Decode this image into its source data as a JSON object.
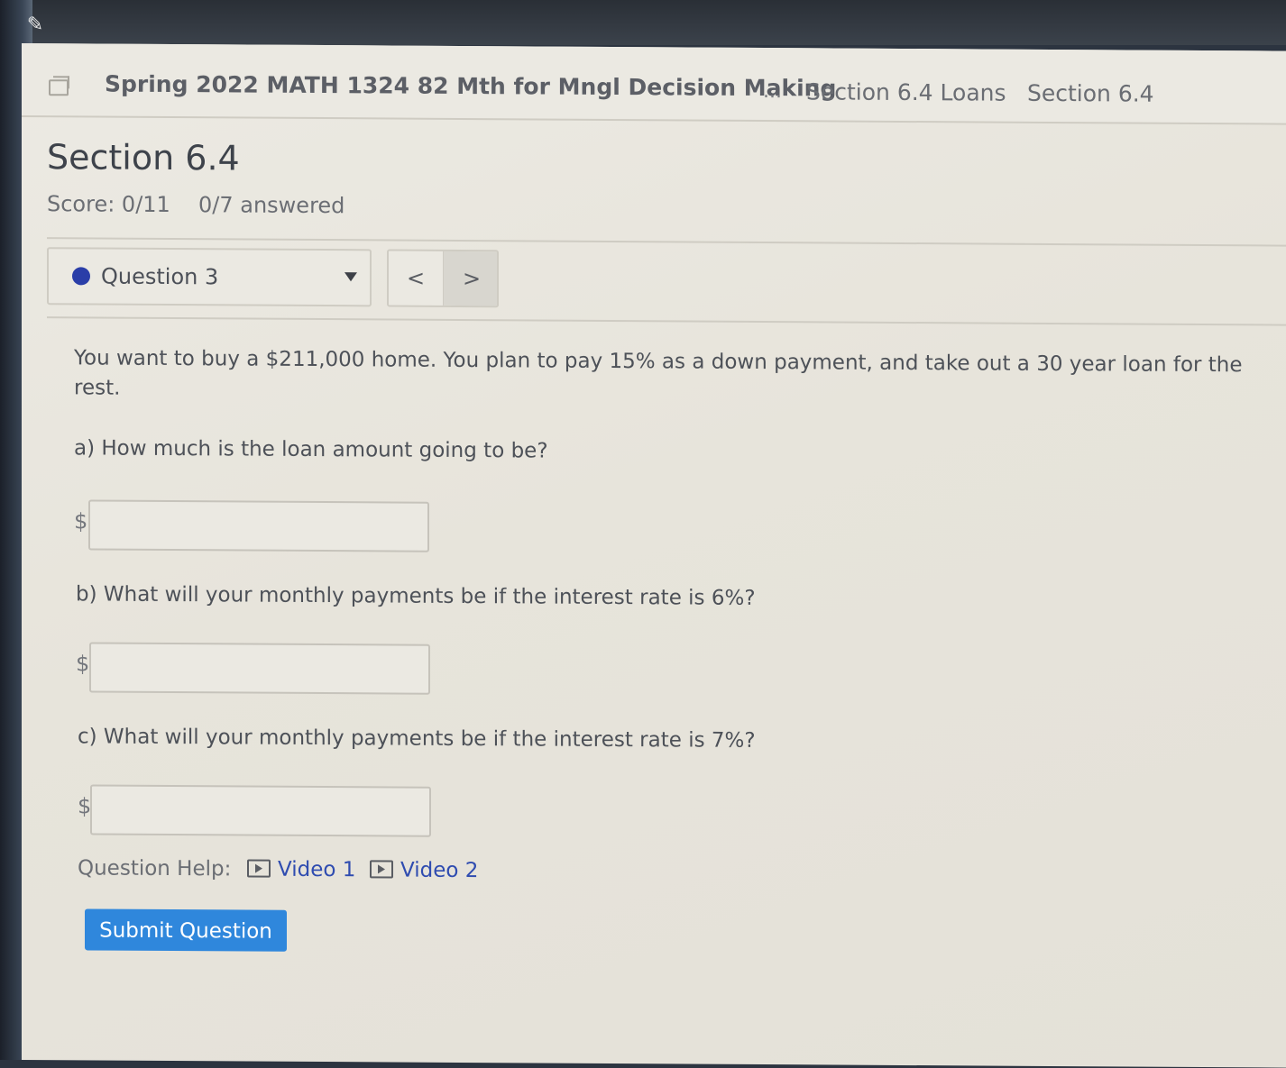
{
  "header": {
    "course_title": "Spring 2022 MATH 1324 82 Mth for Mngl Decision Making",
    "breadcrumb_ellipsis": "...",
    "breadcrumb_items": [
      "Section 6.4 Loans",
      "Section 6.4"
    ]
  },
  "page": {
    "title": "Section 6.4",
    "score": "Score: 0/11",
    "answered": "0/7 answered"
  },
  "question_nav": {
    "selected": "Question 3",
    "prev_label": "<",
    "next_label": ">"
  },
  "question": {
    "prompt": "You want to buy a $211,000 home. You plan to pay 15% as a down payment, and take out a 30 year loan for the rest.",
    "parts": [
      {
        "label": "a) How much is the loan amount going to be?",
        "prefix": "$",
        "value": ""
      },
      {
        "label": "b) What will your monthly payments be if the interest rate is 6%?",
        "prefix": "$",
        "value": ""
      },
      {
        "label": "c) What will your monthly payments be if the interest rate is 7%?",
        "prefix": "$",
        "value": ""
      }
    ]
  },
  "help": {
    "label": "Question Help:",
    "videos": [
      "Video 1",
      "Video 2"
    ]
  },
  "submit_label": "Submit Question",
  "colors": {
    "accent": "#2f87dc",
    "link": "#2f4cb0",
    "status_dot": "#2a3ea8"
  }
}
